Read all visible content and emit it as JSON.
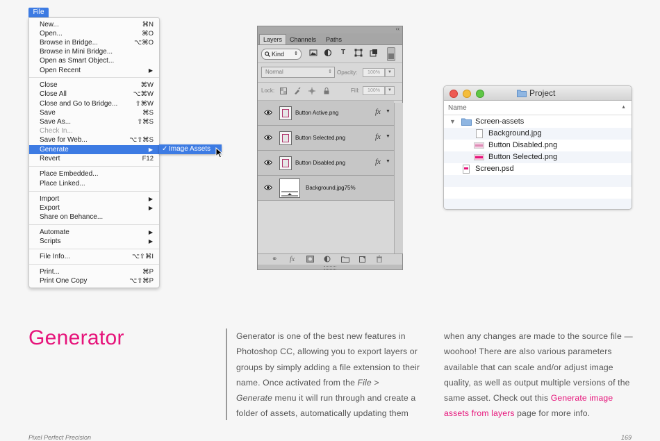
{
  "file_menu": {
    "title": "File",
    "items": [
      {
        "label": "New...",
        "shortcut": "⌘N"
      },
      {
        "label": "Open...",
        "shortcut": "⌘O"
      },
      {
        "label": "Browse in Bridge...",
        "shortcut": "⌥⌘O"
      },
      {
        "label": "Browse in Mini Bridge..."
      },
      {
        "label": "Open as Smart Object..."
      },
      {
        "label": "Open Recent",
        "submenu_arrow": "▶"
      },
      {
        "label": "Close",
        "shortcut": "⌘W"
      },
      {
        "label": "Close All",
        "shortcut": "⌥⌘W"
      },
      {
        "label": "Close and Go to Bridge...",
        "shortcut": "⇧⌘W"
      },
      {
        "label": "Save",
        "shortcut": "⌘S"
      },
      {
        "label": "Save As...",
        "shortcut": "⇧⌘S"
      },
      {
        "label": "Check In..."
      },
      {
        "label": "Save for Web...",
        "shortcut": "⌥⇧⌘S"
      },
      {
        "label": "Generate",
        "submenu_arrow": "▶"
      },
      {
        "label": "Revert",
        "shortcut": "F12"
      },
      {
        "label": "Place Embedded..."
      },
      {
        "label": "Place Linked..."
      },
      {
        "label": "Import",
        "submenu_arrow": "▶"
      },
      {
        "label": "Export",
        "submenu_arrow": "▶"
      },
      {
        "label": "Share on Behance..."
      },
      {
        "label": "Automate",
        "submenu_arrow": "▶"
      },
      {
        "label": "Scripts",
        "submenu_arrow": "▶"
      },
      {
        "label": "File Info...",
        "shortcut": "⌥⇧⌘I"
      },
      {
        "label": "Print...",
        "shortcut": "⌘P"
      },
      {
        "label": "Print One Copy",
        "shortcut": "⌥⇧⌘P"
      }
    ],
    "disabled_item": "Check In...",
    "highlighted_item": "Generate",
    "submenu": {
      "check": "✓",
      "label": "Image Assets"
    }
  },
  "layers_panel": {
    "collapse_glyph": "‹‹",
    "tabs": [
      "Layers",
      "Channels",
      "Paths"
    ],
    "active_tab": "Layers",
    "filter_kind": "Kind",
    "blend_mode": "Normal",
    "opacity_label": "Opacity:",
    "opacity_value": "100%",
    "lock_label": "Lock:",
    "fill_label": "Fill:",
    "fill_value": "100%",
    "fx_label": "fx",
    "layers": [
      {
        "name": "Button Active.png",
        "has_fx": true
      },
      {
        "name": "Button Selected.png",
        "has_fx": true
      },
      {
        "name": "Button Disabled.png",
        "has_fx": true
      },
      {
        "name": "Background.jpg75%",
        "has_fx": false
      }
    ]
  },
  "finder": {
    "title": "Project",
    "column_header": "Name",
    "sort_glyph": "▲",
    "disclosure_glyph": "▼",
    "rows": [
      {
        "name": "Screen-assets",
        "type": "folder"
      },
      {
        "name": "Background.jpg",
        "type": "file"
      },
      {
        "name": "Button Disabled.png",
        "type": "image"
      },
      {
        "name": "Button Selected.png",
        "type": "image"
      },
      {
        "name": "Screen.psd",
        "type": "psd"
      }
    ]
  },
  "article": {
    "heading": "Generator",
    "col1_a": "Generator is one of the best new features in Photoshop CC, allowing you to export layers or groups by simply adding a file extension to their name. Once activated from the ",
    "col1_italic1": "File >",
    "col1_italic2": "Generate",
    "col1_b": " menu it will run through and create a folder of assets, automatically updating them",
    "col2_a": "when any changes are made to the source file — woohoo! There are also various parameters available that can scale and/or adjust image quality, as well as output multiple versions of the same asset. Check out this ",
    "col2_link": "Generate image assets from layers",
    "col2_b": " page for more info."
  },
  "footer": {
    "left": "Pixel Perfect Precision",
    "right": "169"
  },
  "colors": {
    "accent_pink": "#e6137a",
    "menu_highlight": "#3d7be3",
    "folder_blue": "#8fb6e2"
  }
}
